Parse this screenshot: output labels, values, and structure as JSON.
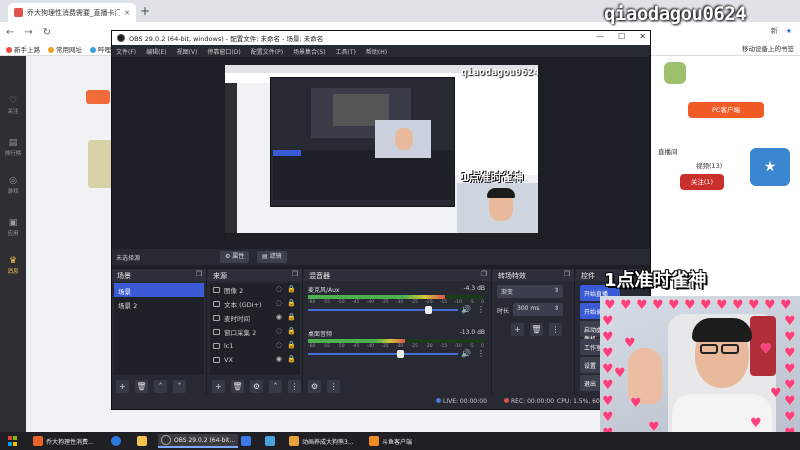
{
  "browser": {
    "tab_title": "乔大狗理性消费需要_直播卡门 -",
    "bookmarks": [
      "新手上路",
      "常用网址",
      "哔哩"
    ],
    "bookmarks_right": "移动设备上的书签",
    "addr_right_text": "新"
  },
  "obs": {
    "title": "OBS 29.0.2 (64-bit, windows) - 配置文件: 未命名 - 场景: 未命名",
    "menu": [
      "文件(F)",
      "编辑(E)",
      "视图(V)",
      "停靠窗口(D)",
      "配置文件(P)",
      "场景集合(S)",
      "工具(T)",
      "帮助(H)"
    ],
    "no_source": "未选择源",
    "props_btn": "属性",
    "filters_btn": "滤镜",
    "docks": {
      "scenes": {
        "title": "场景",
        "items": [
          "场景",
          "场景 2"
        ]
      },
      "sources": {
        "title": "来源",
        "items": [
          "图像 2",
          "文本 (GDI+)",
          "麦时时间",
          "窗口采集 2",
          "lc1",
          "VX"
        ]
      },
      "mixer": {
        "title": "混音器",
        "channels": [
          {
            "name": "麦克风/Aux",
            "db": "-4.3 dB",
            "level": 0.78,
            "fader": 0.82
          },
          {
            "name": "桌面音频",
            "db": "-13.0 dB",
            "level": 0.55,
            "fader": 0.62
          }
        ],
        "ticks": [
          "-60",
          "-55",
          "-50",
          "-45",
          "-40",
          "-35",
          "-30",
          "-25",
          "-20",
          "-15",
          "-10",
          "-5",
          "0"
        ]
      },
      "transitions": {
        "title": "转场特效",
        "select": "渐变",
        "duration_label": "时长",
        "duration": "300 ms"
      },
      "controls": {
        "title": "控件",
        "items": [
          "开始直播",
          "开始录制",
          "启动虚拟摄像机",
          "工作室模式",
          "设置",
          "退出"
        ]
      }
    },
    "status": {
      "live": "LIVE: 00:00:00",
      "rec": "REC: 00:00:00",
      "cpu": "CPU: 1.5%, 60.00 fps"
    }
  },
  "overlay": {
    "watermark": "qiaodagou0624",
    "title": "1点准时雀神"
  },
  "site": {
    "nav": [
      "关注",
      "排行榜",
      "游戏",
      "应用",
      "消息"
    ],
    "right_btn": "PC客户端",
    "right_links": [
      "直播间",
      "视频(13)",
      "关注(1)"
    ]
  },
  "taskbar": {
    "items": [
      {
        "label": "乔大狗理性消费...",
        "color": "#e8632b"
      },
      {
        "label": "",
        "color": "#2a7ae2"
      },
      {
        "label": "",
        "color": "#f2c14e"
      },
      {
        "label": "OBS 29.0.2 (64-bit...",
        "color": "#333"
      },
      {
        "label": "",
        "color": "#3b78e7"
      },
      {
        "label": "",
        "color": "#4aa3df"
      },
      {
        "label": "动画养成大狗熊3...",
        "color": "#e6a13a"
      },
      {
        "label": "斗鱼客户端",
        "color": "#f08a24"
      }
    ]
  },
  "colors": {
    "obs_bg": "#272a33",
    "accent": "#3b5bd6",
    "heart": "#ff3f7c"
  }
}
